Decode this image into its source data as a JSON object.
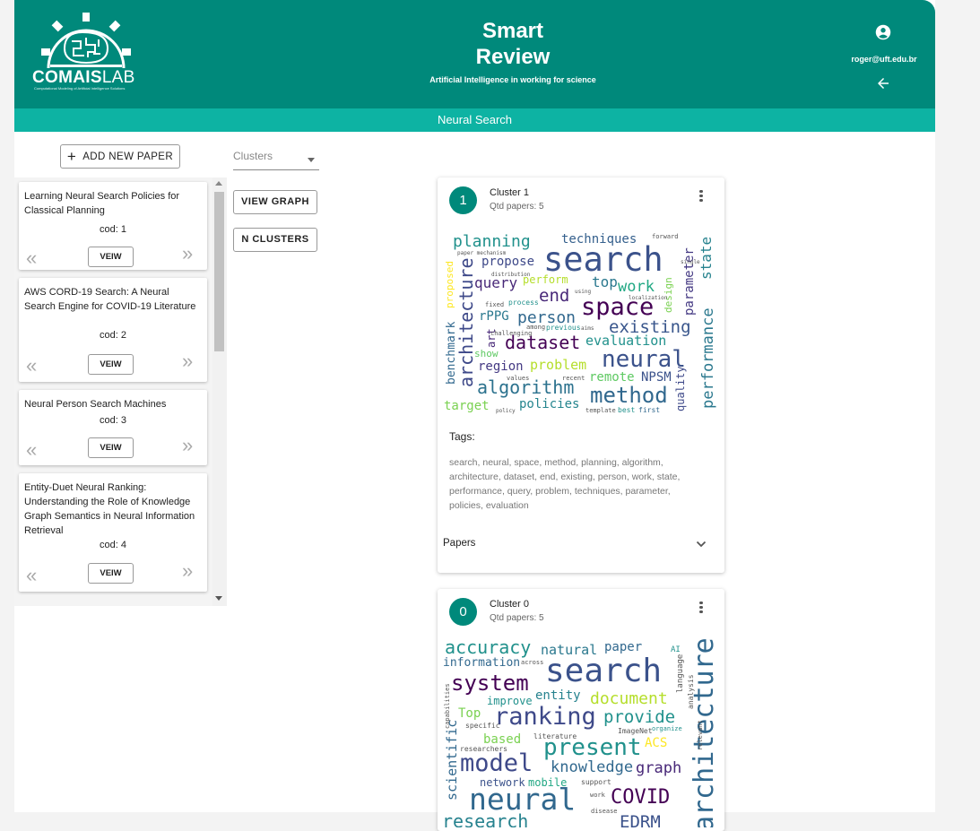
{
  "header": {
    "logo_text_bold": "COMAIS",
    "logo_text_light": "LAB",
    "logo_subtext": "Computational Modeling of Artificial Intelligence Solutions",
    "title_line1": "Smart",
    "title_line2": "Review",
    "subtitle": "Artificial Intelligence in working for science",
    "user_email": "roger@uft.edu.br",
    "user_icon": "account-circle-icon",
    "back_icon": "arrow-back-icon"
  },
  "subbar": {
    "label": "Neural Search"
  },
  "sidebar": {
    "add_button_label": "ADD NEW PAPER",
    "papers": [
      {
        "title": "Learning Neural Search Policies for Classical Planning",
        "cod": "cod: 1",
        "view_label": "VEIW"
      },
      {
        "title": "AWS CORD-19 Search: A Neural Search Engine for COVID-19 Literature",
        "cod": "cod: 2",
        "view_label": "VEIW"
      },
      {
        "title": "Neural Person Search Machines",
        "cod": "cod: 3",
        "view_label": "VEIW"
      },
      {
        "title": "Entity-Duet Neural Ranking: Understanding the Role of Knowledge Graph Semantics in Neural Information Retrieval",
        "cod": "cod: 4",
        "view_label": "VEIW"
      }
    ],
    "chevron_left": "«",
    "chevron_right": "»"
  },
  "controls": {
    "clusters_placeholder": "Clusters",
    "view_graph_label": "VIEW GRAPH",
    "n_clusters_label": "N CLUSTERS"
  },
  "clusters": [
    {
      "number": "1",
      "name": "Cluster 1",
      "qtd": "Qtd papers: 5",
      "tags_label": "Tags:",
      "tags": "search, neural, space, method, planning, algorithm, architecture, dataset, end, existing, person, work, state, performance, query, problem, techniques, parameter, policies, evaluation",
      "papers_label": "Papers"
    },
    {
      "number": "0",
      "name": "Cluster 0",
      "qtd": "Qtd papers: 5"
    }
  ],
  "colors": {
    "primary": "#00897b",
    "subbar": "#0db3a3"
  }
}
